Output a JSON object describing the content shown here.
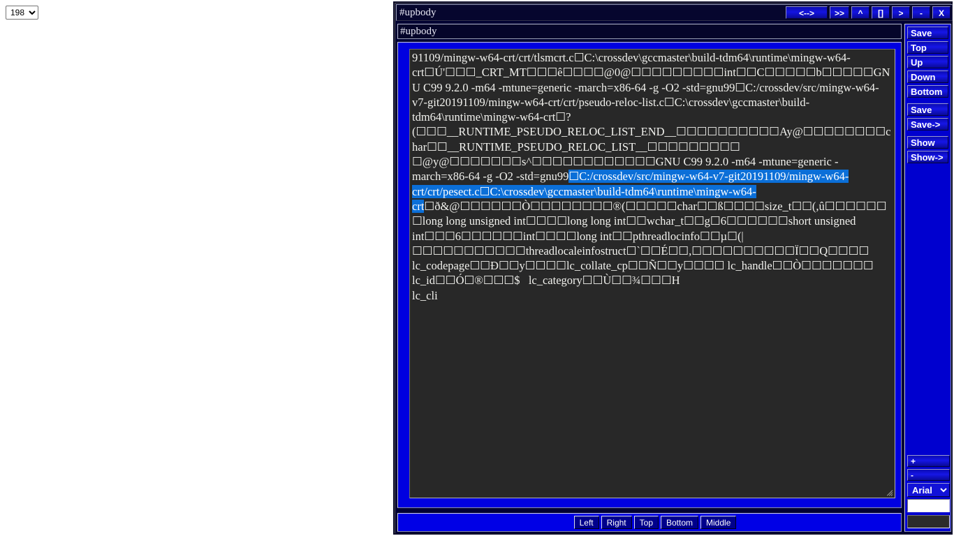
{
  "page": {
    "background": "#ffffff",
    "accent_blue": "#0000e0",
    "selection_blue": "#0b6fd8",
    "panel_dark": "#282828",
    "title_navy": "#06062e"
  },
  "corner_select": {
    "name": "page-number-select",
    "value": "198",
    "options": [
      "198"
    ]
  },
  "window": {
    "title": "#upbody",
    "titlebar_buttons": [
      {
        "label": "<-->",
        "name": "split-toggle-button",
        "wide": true
      },
      {
        "label": ">>",
        "name": "forward-button",
        "wide": false
      },
      {
        "label": "^",
        "name": "up-button",
        "wide": false
      },
      {
        "label": "[]",
        "name": "maximize-button",
        "wide": false
      },
      {
        "label": ">",
        "name": "next-button",
        "wide": false
      },
      {
        "label": "-",
        "name": "minimize-button",
        "wide": false
      },
      {
        "label": "X",
        "name": "close-button",
        "wide": false
      }
    ]
  },
  "name_field": {
    "value": "#upbody",
    "placeholder": "#upbody"
  },
  "editor": {
    "text_before_selection": "91109/mingw-w64-crt/crt/tlsmcrt.c☐C:\\crossdev\\gccmaster\\build-tdm64\\runtime\\mingw-w64-crt☐Ú'☐☐☐_CRT_MT☐☐☐ê☐☐☐☐@0@☐☐☐☐☐☐☐☐☐int☐☐C☐☐☐☐☐b☐☐☐☐☐GNU C99 9.2.0 -m64 -mtune=generic -march=x86-64 -g -O2 -std=gnu99☐C:/crossdev/src/mingw-w64-v7-git20191109/mingw-w64-crt/crt/pseudo-reloc-list.c☐C:\\crossdev\\gccmaster\\build-tdm64\\runtime\\mingw-w64-crt☐?\n(☐☐☐__RUNTIME_PSEUDO_RELOC_LIST_END__☐☐☐☐☐☐☐☐☐☐Ay@☐☐☐☐☐☐☐☐char☐☐__RUNTIME_PSEUDO_RELOC_LIST__☐☐☐☐☐☐☐☐☐    ☐@y@☐☐☐☐☐☐☐s^☐☐☐☐☐☐☐☐☐☐☐☐GNU C99 9.2.0 -m64 -mtune=generic -march=x86-64 -g -O2 -std=gnu99",
    "selected_text": "☐C:/crossdev/src/mingw-w64-v7-git20191109/mingw-w64-crt/crt/pesect.c☐C:\\crossdev\\gccmaster\\build-tdm64\\runtime\\mingw-w64-crt",
    "text_after_selection": "☐ð&@☐☐☐☐☐☐Ò☐☐☐☐☐☐☐☐®(☐☐☐☐☐char☐☐ß☐☐☐☐size_t☐☐(,û☐☐☐☐☐☐☐long long unsigned int☐☐☐☐long long int☐☐wchar_t☐☐g☐6☐☐☐☐☐☐short unsigned int☐☐☐6☐☐☐☐☐☐int☐☐☐☐long int☐☐pthreadlocinfo☐☐µ☐(|☐☐☐☐☐☐☐☐☐☐☐threadlocaleinfostruct☐`☐☐É☐☐,☐☐☐☐☐☐☐☐☐☐Ï☐☐Q☐☐☐☐  lc_codepage☐☐Ð☐☐y☐☐☐☐lc_collate_cp☐☐Ñ☐☐y☐☐☐☐ lc_handle☐☐Ò☐☐☐☐☐☐☐ lc_id☐☐Ó☐®☐☐☐$   lc_category☐☐Ù☐☐¾☐☐☐H\nlc_cli"
  },
  "sidebar": {
    "groups": [
      {
        "buttons": [
          {
            "label": "Save",
            "name": "sidebar-save-button"
          },
          {
            "label": "Top",
            "name": "sidebar-top-button"
          },
          {
            "label": "Up",
            "name": "sidebar-up-button"
          },
          {
            "label": "Down",
            "name": "sidebar-down-button"
          },
          {
            "label": "Bottom",
            "name": "sidebar-bottom-button"
          }
        ]
      },
      {
        "buttons": [
          {
            "label": "Save",
            "name": "sidebar-save2-button"
          },
          {
            "label": "Save->",
            "name": "sidebar-save-as-button"
          }
        ]
      },
      {
        "buttons": [
          {
            "label": "Show",
            "name": "sidebar-show-button"
          },
          {
            "label": "Show->",
            "name": "sidebar-show-as-button"
          }
        ]
      }
    ],
    "bottom_controls": {
      "increase_label": "+",
      "decrease_label": "-",
      "font_select": {
        "value": "Arial",
        "options": [
          "Arial"
        ]
      },
      "text_input_value": "",
      "text_input_placeholder": "",
      "swatch_color": "#2b2b2b"
    }
  },
  "bottom_bar": {
    "buttons": [
      {
        "label": "Left",
        "name": "align-left-button"
      },
      {
        "label": "Right",
        "name": "align-right-button"
      },
      {
        "label": "Top",
        "name": "align-top-button"
      },
      {
        "label": "Bottom",
        "name": "align-bottom-button"
      },
      {
        "label": "Middle",
        "name": "align-middle-button"
      }
    ]
  }
}
